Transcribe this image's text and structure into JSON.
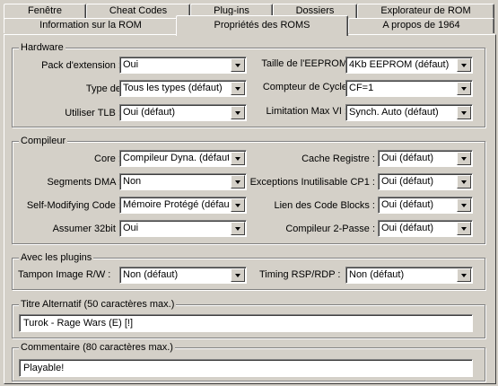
{
  "tabs": {
    "row1": [
      "Fenêtre",
      "Cheat Codes",
      "Plug-ins",
      "Dossiers",
      "Explorateur de ROM"
    ],
    "row2": [
      "Information sur la ROM",
      "Propriétés des ROMS",
      "A propos de 1964"
    ],
    "active": "Propriétés des ROMS"
  },
  "hardware": {
    "title": "Hardware",
    "pack_label": "Pack d'extension :",
    "pack_value": "Oui",
    "type_label": "Type de",
    "type_value": "Tous les types (défaut)",
    "tlb_label": "Utiliser TLB :",
    "tlb_value": "Oui (défaut)",
    "eeprom_label": "Taille de l'EEPROM",
    "eeprom_value": "4Kb EEPROM (défaut)",
    "cycle_label": "Compteur de Cycle",
    "cycle_value": "CF=1",
    "vi_label": "Limitation Max VI :",
    "vi_value": "Synch. Auto (défaut)"
  },
  "compiler": {
    "title": "Compileur",
    "core_label": "Core :",
    "core_value": "Compileur Dyna. (défaut)",
    "dma_label": "Segments DMA :",
    "dma_value": "Non",
    "smc_label": "Self-Modifying Code :",
    "smc_value": "Mémoire Protégé (défaut)",
    "a32_label": "Assumer 32bit :",
    "a32_value": "Oui",
    "cache_label": "Cache Registre :",
    "cache_value": "Oui (défaut)",
    "cp1_label": "Exceptions Inutilisable CP1 :",
    "cp1_value": "Oui (défaut)",
    "link_label": "Lien des Code Blocks :",
    "link_value": "Oui (défaut)",
    "pass_label": "Compileur 2-Passe :",
    "pass_value": "Oui (défaut)"
  },
  "plugins": {
    "title": "Avec les plugins",
    "buffer_label": "Tampon Image R/W :",
    "buffer_value": "Non (défaut)",
    "timing_label": "Timing RSP/RDP :",
    "timing_value": "Non (défaut)"
  },
  "alt_title": {
    "title": "Titre Alternatif (50 caractères max.)",
    "value": "Turok - Rage Wars (E) [!]"
  },
  "comment": {
    "title": "Commentaire (80 caractères max.)",
    "value": "Playable!"
  }
}
